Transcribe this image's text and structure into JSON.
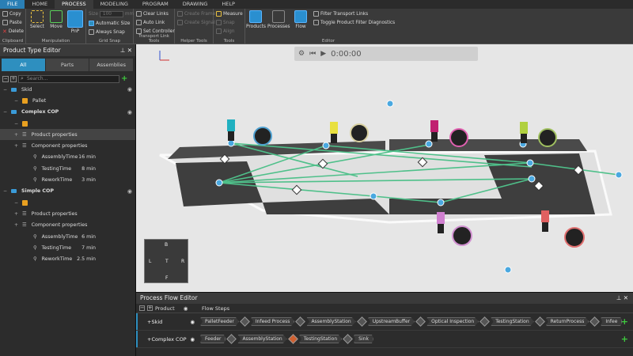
{
  "menu": [
    "FILE",
    "HOME",
    "PROCESS",
    "MODELING",
    "PROGRAM",
    "DRAWING",
    "HELP"
  ],
  "ribbon": {
    "clipboard": {
      "copy": "Copy",
      "paste": "Paste",
      "delete": "Delete",
      "label": "Clipboard"
    },
    "manipulation": {
      "select": "Select",
      "move": "Move",
      "pnp": "PnP",
      "label": "Manipulation"
    },
    "grid_snap": {
      "size_label": "Size",
      "size_value": "100",
      "size_unit": "mm",
      "automatic_size": "Automatic Size",
      "always_snap": "Always Snap",
      "label": "Grid Snap"
    },
    "transport_link": {
      "clear_links": "Clear Links",
      "auto_link": "Auto Link",
      "set_controller": "Set Controller",
      "label": "Transport Link Tools"
    },
    "helper": {
      "create_frame": "Create Frame",
      "create_signal": "Create Signal",
      "label": "Helper Tools"
    },
    "tools": {
      "measure": "Measure",
      "snap": "Snap",
      "align": "Align",
      "label": "Tools"
    },
    "editor": {
      "products": "Products",
      "processes": "Processes",
      "flow": "Flow",
      "filter_transport": "Filter Transport Links",
      "toggle_filter": "Toggle Product Filter Diagnostics",
      "label": "Editor"
    }
  },
  "product_type_editor": {
    "title": "Product Type Editor",
    "tabs": [
      "All",
      "Parts",
      "Assemblies"
    ],
    "search_placeholder": "Search...",
    "tree": [
      {
        "label": "Skid",
        "indent": 0,
        "kind": "folder",
        "eye": true
      },
      {
        "label": "Pallet",
        "indent": 1,
        "kind": "product"
      },
      {
        "label": "Complex COP",
        "indent": 0,
        "kind": "folder",
        "eye": true,
        "bold": true
      },
      {
        "label": "",
        "indent": 1,
        "kind": "product"
      },
      {
        "label": "Product properties",
        "indent": 1,
        "kind": "props",
        "selected": true
      },
      {
        "label": "Component properties",
        "indent": 1,
        "kind": "props"
      },
      {
        "label": "AssemblyTime",
        "indent": 2,
        "kind": "prop",
        "value": "16 min"
      },
      {
        "label": "TestingTime",
        "indent": 2,
        "kind": "prop",
        "value": "8 min"
      },
      {
        "label": "ReworkTime",
        "indent": 2,
        "kind": "prop",
        "value": "3 min"
      },
      {
        "label": "Simple COP",
        "indent": 0,
        "kind": "folder",
        "eye": true,
        "bold": true
      },
      {
        "label": "",
        "indent": 1,
        "kind": "product"
      },
      {
        "label": "Product properties",
        "indent": 1,
        "kind": "props"
      },
      {
        "label": "Component properties",
        "indent": 1,
        "kind": "props"
      },
      {
        "label": "AssemblyTime",
        "indent": 2,
        "kind": "prop",
        "value": "6 min"
      },
      {
        "label": "TestingTime",
        "indent": 2,
        "kind": "prop",
        "value": "7 min"
      },
      {
        "label": "ReworkTime",
        "indent": 2,
        "kind": "prop",
        "value": "2.5 min"
      }
    ]
  },
  "viewport": {
    "timecode": "0:00:00",
    "nav_cube": {
      "top": "T",
      "back": "B",
      "front": "F",
      "left": "L",
      "right": "R"
    }
  },
  "process_flow_editor": {
    "title": "Process Flow Editor",
    "col_product": "Product",
    "col_steps": "Flow Steps",
    "rows": [
      {
        "product": "Skid",
        "steps": [
          "PalletFeeder",
          "Infeed Process",
          "AssemblyStation",
          "UpstreamBuffer",
          "Optical Inspection",
          "TestingStation",
          "ReturnProcess",
          "Infee"
        ]
      },
      {
        "product": "Complex COP",
        "steps": [
          "Feeder",
          "AssemblyStation",
          "TestingStation",
          "Sink"
        ]
      }
    ]
  },
  "colors": {
    "accent": "#2e8fbf",
    "flow_line": "#4fc08a",
    "node": "#4aa8e0"
  }
}
